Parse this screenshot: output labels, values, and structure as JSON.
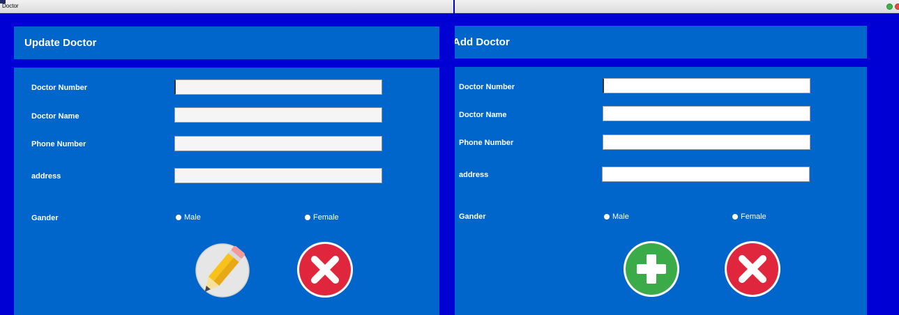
{
  "update_window": {
    "title": "Doctor",
    "header": "Update Doctor",
    "fields": [
      {
        "label": "Doctor Number",
        "value": ""
      },
      {
        "label": "Doctor Name",
        "value": ""
      },
      {
        "label": "Phone Number",
        "value": ""
      },
      {
        "label": "address",
        "value": ""
      }
    ],
    "gender_label": "Gander",
    "gender_options": [
      "Male",
      "Female"
    ],
    "buttons": {
      "primary_icon": "pencil-icon",
      "cancel_icon": "close-icon"
    }
  },
  "add_window": {
    "header": "Add Doctor",
    "fields": [
      {
        "label": "Doctor Number",
        "value": ""
      },
      {
        "label": "Doctor Name",
        "value": ""
      },
      {
        "label": "Phone Number",
        "value": ""
      },
      {
        "label": "address",
        "value": ""
      }
    ],
    "gender_label": "Gander",
    "gender_options": [
      "Male",
      "Female"
    ],
    "buttons": {
      "primary_icon": "plus-icon",
      "cancel_icon": "close-icon"
    }
  },
  "colors": {
    "window_bg": "#0000d5",
    "panel_bg": "#0066cc",
    "add_button": "#3bab4a",
    "cancel_button": "#e0263c",
    "pencil_yellow": "#f7c21a"
  }
}
